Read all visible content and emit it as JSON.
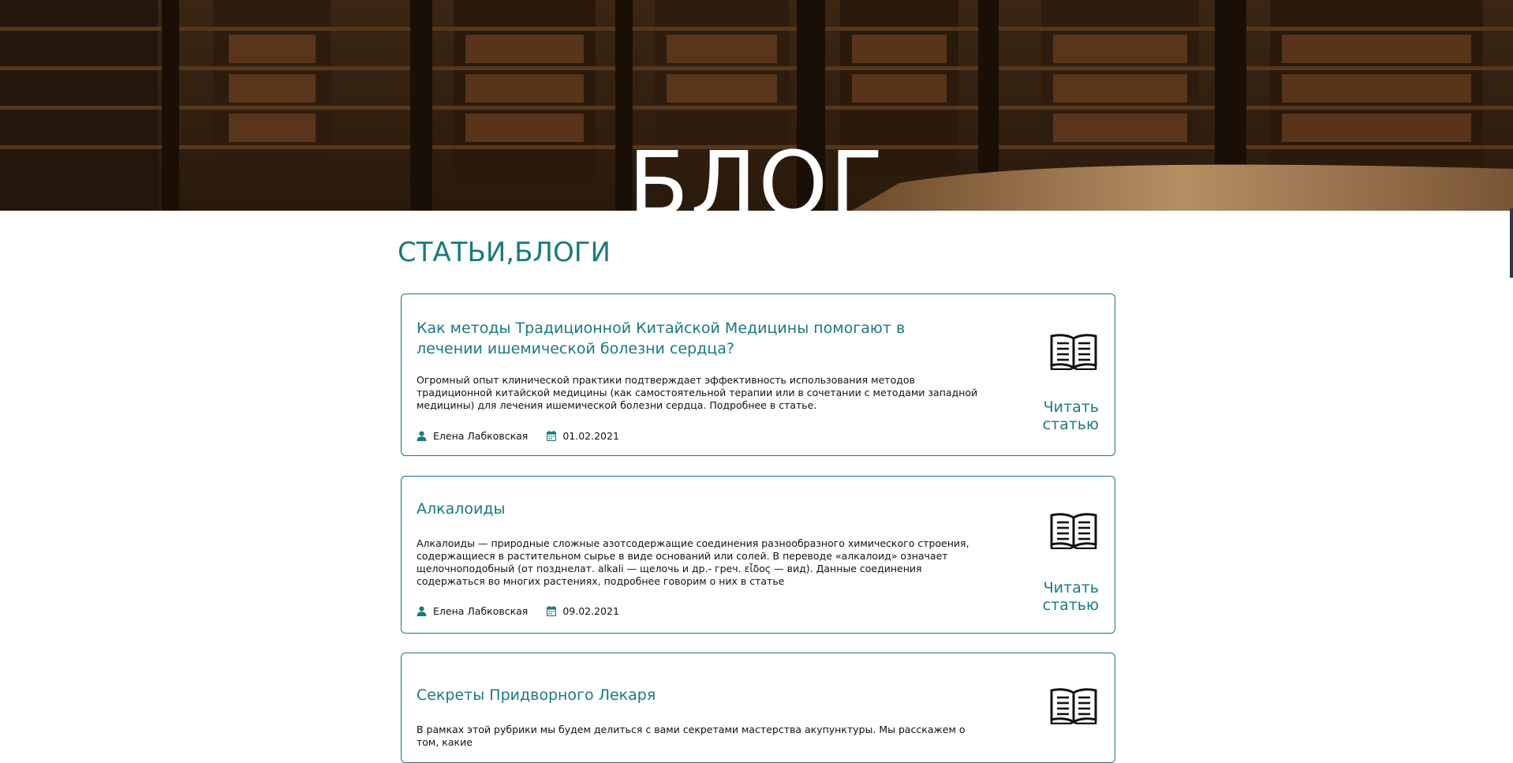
{
  "hero": {
    "title": "БЛОГ"
  },
  "section": {
    "title": "СТАТЬИ,БЛОГИ"
  },
  "articles": [
    {
      "title": "Как методы Традиционной Китайской Медицины помогают в лечении ишемической болезни сердца?",
      "excerpt": "Огромный опыт клинической практики подтверждает эффективность использования методов традиционной китайской медицины (как самостоятельной терапии или в сочетании с методами западной медицины) для лечения ишемической болезни сердца. Подробнее в статье.",
      "author": "Елена Лабковская",
      "date": "01.02.2021",
      "read_label": "Читать статью"
    },
    {
      "title": "Алкалоиды",
      "excerpt": "Алкалоиды — природные сложные азотсодержащие соединения разнообразного химического строения, содержащиеся в растительном сырье в виде оснований или солей. В переводе «алкалоид» означает щелочноподобный (от позднелат. alkali — щелочь и др.- греч. εἶδος — вид). Данные соединения содержаться во многих растениях, подробнее говорим о них в статье",
      "author": "Елена Лабковская",
      "date": "09.02.2021",
      "read_label": "Читать статью"
    },
    {
      "title": "Секреты Придворного Лекаря",
      "excerpt": "В рамках этой рубрики мы будем делиться с вами секретами мастерства акупунктуры. Мы расскажем о том, какие",
      "author": "",
      "date": "",
      "read_label": ""
    }
  ],
  "colors": {
    "accent": "#1a7a7a",
    "text": "#111111"
  },
  "icons": {
    "author": "user-icon",
    "date": "calendar-icon",
    "article": "open-book-icon"
  }
}
